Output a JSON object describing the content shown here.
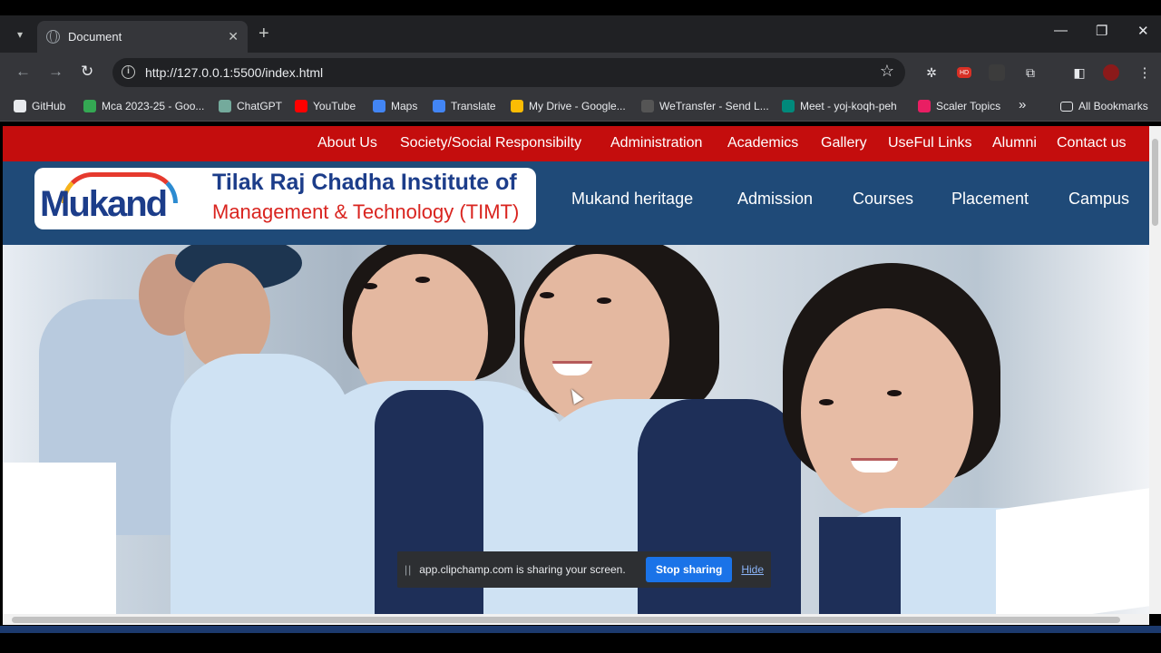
{
  "browser": {
    "tab_title": "Document",
    "url": "http://127.0.0.1:5500/index.html",
    "bookmarks": [
      {
        "label": "GitHub",
        "color": "#e8eaed"
      },
      {
        "label": "Mca 2023-25 - Goo...",
        "color": "#34a853"
      },
      {
        "label": "ChatGPT",
        "color": "#74aa9c"
      },
      {
        "label": "YouTube",
        "color": "#ff0000"
      },
      {
        "label": "Maps",
        "color": "#4285f4"
      },
      {
        "label": "Translate",
        "color": "#4285f4"
      },
      {
        "label": "My Drive - Google...",
        "color": "#fbbc04"
      },
      {
        "label": "WeTransfer - Send L...",
        "color": "#555555"
      },
      {
        "label": "Meet - yoj-koqh-peh",
        "color": "#00897b"
      },
      {
        "label": "Scaler Topics",
        "color": "#e91e63"
      }
    ],
    "all_bookmarks": "All Bookmarks",
    "overflow": "»"
  },
  "site": {
    "top_nav": [
      "About Us",
      "Society/Social Responsibilty",
      "Administration",
      "Academics",
      "Gallery",
      "UseFul Links",
      "Alumni",
      "Contact us"
    ],
    "logo": {
      "brand": "Mukand",
      "line1": "Tilak Raj Chadha Institute of",
      "line2": "Management & Technology (TIMT)"
    },
    "main_nav": [
      "Mukand heritage",
      "Admission",
      "Courses",
      "Placement",
      "Campus"
    ]
  },
  "share_banner": {
    "pause": "||",
    "message": "app.clipchamp.com is sharing your screen.",
    "stop": "Stop sharing",
    "hide": "Hide"
  },
  "colors": {
    "top_nav_bg": "#c40d0d",
    "header_bg": "#1f4a78",
    "accent": "#1a73e8"
  }
}
